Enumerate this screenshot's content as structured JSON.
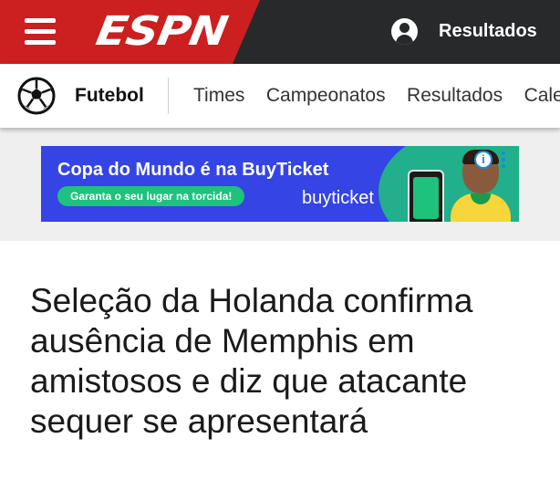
{
  "header": {
    "brand": "ESPN",
    "results_label": "Resultados",
    "menu_icon": "hamburger-icon",
    "profile_icon": "user-icon",
    "colors": {
      "brand_red": "#cc1f1f",
      "bar": "#28292b"
    }
  },
  "sport_nav": {
    "sport_icon": "soccer-ball-icon",
    "sport_title": "Futebol",
    "links": [
      "Times",
      "Campeonatos",
      "Resultados",
      "Calendário"
    ]
  },
  "ad": {
    "headline": "Copa do Mundo é na BuyTicket",
    "cta": "Garanta o seu lugar na torcida!",
    "brand": "buyticket",
    "info_icon": "ad-info-icon",
    "menu_icon": "ad-menu-icon",
    "colors": {
      "background": "#3444e5",
      "accent": "#1ec27c"
    }
  },
  "article": {
    "title": "Seleção da Holanda confirma ausência de Memphis em amistosos e diz que atacante sequer se apresentará"
  }
}
